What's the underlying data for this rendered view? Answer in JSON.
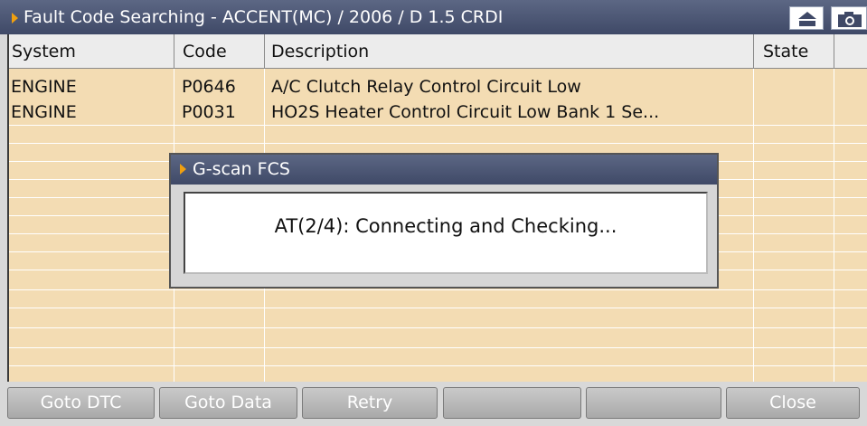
{
  "window": {
    "title": "Fault Code Searching - ACCENT(MC) / 2006 / D 1.5 CRDI",
    "buttons": [
      {
        "icon": "home-icon"
      },
      {
        "icon": "camera-icon"
      }
    ]
  },
  "table": {
    "columns": [
      "System",
      "Code",
      "Description",
      "State"
    ],
    "rows": [
      {
        "system": "ENGINE",
        "code": "P0646",
        "description": "A/C Clutch Relay Control Circuit Low",
        "state": ""
      },
      {
        "system": "ENGINE",
        "code": "P0031",
        "description": "HO2S Heater Control Circuit Low Bank 1  Se...",
        "state": ""
      }
    ]
  },
  "dialog": {
    "title": "G-scan FCS",
    "message": "AT(2/4): Connecting and Checking..."
  },
  "toolbar": {
    "goto_dtc": "Goto DTC",
    "goto_data": "Goto Data",
    "retry": "Retry",
    "blank1": "",
    "blank2": "",
    "close": "Close"
  },
  "colors": {
    "titlebar": "#4a5472",
    "table_bg": "#f3dcb3",
    "accent_arrow": "#f0a010",
    "button_disabled": "#b8b8b8"
  }
}
